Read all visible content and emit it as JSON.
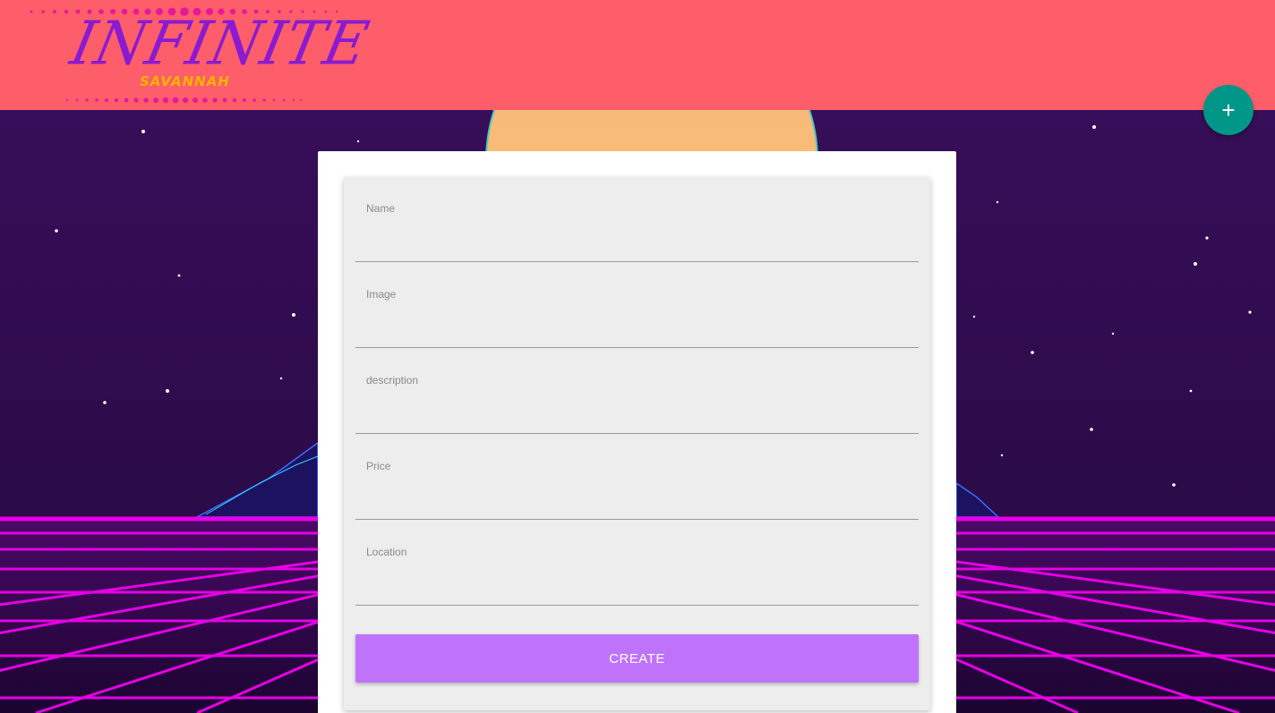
{
  "header": {
    "brand": {
      "title": "INFINITE",
      "subtitle": "SAVANNAH"
    },
    "background_color": "#fe5e6a"
  },
  "fab": {
    "icon": "plus-icon",
    "glyph": "+",
    "color": "#009688"
  },
  "form": {
    "fields": [
      {
        "label": "Name",
        "value": ""
      },
      {
        "label": "Image",
        "value": ""
      },
      {
        "label": "description",
        "value": ""
      },
      {
        "label": "Price",
        "value": ""
      },
      {
        "label": "Location",
        "value": ""
      }
    ],
    "submit_label": "CREATE",
    "submit_color": "#bf73fb"
  },
  "background": {
    "style": "synthwave",
    "sky_color": "#2b0b4d",
    "sun_color": "#f6b27a",
    "grid_color": "#e600e6"
  }
}
